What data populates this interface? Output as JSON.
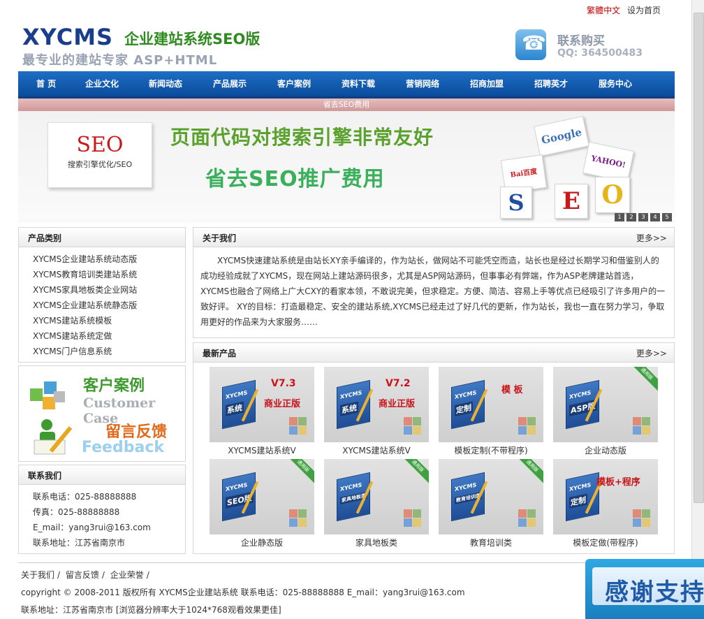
{
  "top_links": {
    "traditional": "繁體中文",
    "homepage": "设为首页"
  },
  "logo": {
    "brand": "XYCMS",
    "product": "企业建站系统SEO版",
    "tagline": "最专业的建站专家  ASP+HTML"
  },
  "contact_header": {
    "label": "联系购买",
    "qq": "QQ: 364500483"
  },
  "nav": [
    "首 页",
    "企业文化",
    "新闻动态",
    "产品展示",
    "客户案例",
    "资料下载",
    "营销网络",
    "招商加盟",
    "招聘英才",
    "服务中心"
  ],
  "banner": {
    "strip": "省去SEO费用",
    "card_title": "SEO",
    "card_sub": "搜索引擎优化/SEO",
    "slogan1": "页面代码对搜索引擎非常友好",
    "slogan2": "省去SEO推广费用",
    "brands": [
      "Google",
      "YAHOO!",
      "Bai百度"
    ],
    "letters": [
      "S",
      "E",
      "O"
    ],
    "slides": [
      "1",
      "2",
      "3",
      "4",
      "5"
    ]
  },
  "categories": {
    "title": "产品类别",
    "items": [
      "XYCMS企业建站系统动态版",
      "XYCMS教育培训类建站系统",
      "XYCMS家具地板类企业网站",
      "XYCMS企业建站系统静态版",
      "XYCMS建站系统模板",
      "XYCMS建站系统定做",
      "XYCMS门户信息系统"
    ]
  },
  "case_feedback": {
    "case_zh": "客户案例",
    "case_en": "Customer Case",
    "feedback_zh": "留言反馈",
    "feedback_en": "Feedback"
  },
  "contact_us": {
    "title": "联系我们",
    "items": [
      "联系电话：025-88888888",
      "传真：025-88888888",
      "E_mail：yang3rui@163.com",
      "联系地址：江苏省南京市"
    ]
  },
  "about": {
    "title": "关于我们",
    "more": "更多>>",
    "text": "XYCMS快速建站系统是由站长XY亲手编译的，作为站长，做网站不可能凭空而造，站长也是经过长期学习和借鉴别人的成功经验成就了XYCMS，现在网站上建站源码很多，尤其是ASP网站源码，但事事必有弊端，作为ASP老牌建站首选，XYCMS也融合了网络上广大CXY的看家本领，不敢说完美，但求稳定。方便、简洁、容易上手等优点已经吸引了许多用户的一致好评。 XY的目标：打造最稳定、安全的建站系统,XYCMS已经走过了好几代的更新，作为站长，我也一直在努力学习，争取用更好的作品来为大家服务……"
  },
  "products": {
    "title": "最新产品",
    "more": "更多>>",
    "items": [
      {
        "caption": "XYCMS建站系统V",
        "box": "系统",
        "version": "V7.3",
        "badge": "商业正版"
      },
      {
        "caption": "XYCMS建站系统V",
        "box": "系统",
        "version": "V7.2",
        "badge": "商业正版"
      },
      {
        "caption": "模板定制(不带程序)",
        "box": "定制",
        "tpl": "模 板"
      },
      {
        "caption": "企业动态版",
        "box": "ASP版",
        "ribbon": "通用版"
      },
      {
        "caption": "企业静态版",
        "box": "SEO版",
        "ribbon": "通用版"
      },
      {
        "caption": "家具地板类",
        "box": "家具地板类",
        "ribbon": "通用版"
      },
      {
        "caption": "教育培训类",
        "box": "教育培训类",
        "ribbon": "通用版"
      },
      {
        "caption": "模板定做(带程序)",
        "box": "定制",
        "tpl": "模板+程序"
      }
    ],
    "box_brand": "XYCMS"
  },
  "footer": {
    "links": [
      "关于我们",
      "留言反馈",
      "企业荣誉"
    ],
    "separator": "/",
    "copyright": "copyright © 2008-2011 版权所有  XYCMS企业建站系统  联系电话：025-88888888 E_mail：yang3rui@163.com",
    "address": "联系地址：江苏省南京市 [浏览器分辨率大于1024*768观看效果更佳]"
  },
  "float_ad": "感谢支持"
}
